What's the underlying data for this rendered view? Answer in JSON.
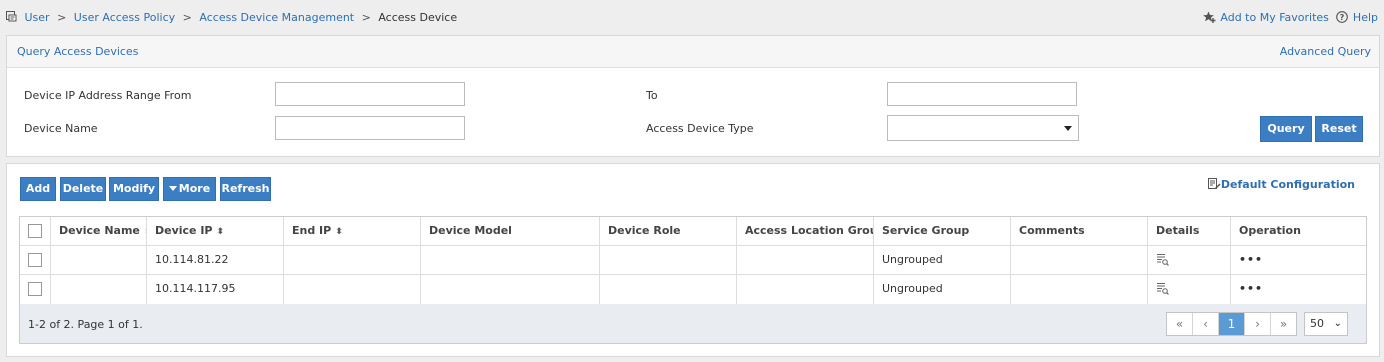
{
  "breadcrumb": {
    "items": [
      "User",
      "User Access Policy",
      "Access Device Management"
    ],
    "current": "Access Device",
    "separator": ">"
  },
  "top_links": {
    "favorites": "Add to My Favorites",
    "help": "Help"
  },
  "query": {
    "title": "Query Access Devices",
    "advanced": "Advanced Query",
    "ip_from_label": "Device IP Address Range From",
    "to_label": "To",
    "name_label": "Device Name",
    "type_label": "Access Device Type",
    "ip_from_value": "",
    "to_value": "",
    "name_value": "",
    "type_value": "",
    "query_button": "Query",
    "reset_button": "Reset"
  },
  "toolbar": {
    "add": "Add",
    "delete": "Delete",
    "modify": "Modify",
    "more": "More",
    "refresh": "Refresh",
    "default_config": "Default Configuration"
  },
  "table": {
    "columns": [
      "Device Name",
      "Device IP",
      "End IP",
      "Device Model",
      "Device Role",
      "Access Location Group",
      "Service Group",
      "Comments",
      "Details",
      "Operation"
    ],
    "rows": [
      {
        "device_name": "",
        "device_ip": "10.114.81.22",
        "end_ip": "",
        "device_model": "",
        "device_role": "",
        "location_group": "",
        "service_group": "Ungrouped",
        "comments": "",
        "operation": "•••"
      },
      {
        "device_name": "",
        "device_ip": "10.114.117.95",
        "end_ip": "",
        "device_model": "",
        "device_role": "",
        "location_group": "",
        "service_group": "Ungrouped",
        "comments": "",
        "operation": "•••"
      }
    ]
  },
  "pagination": {
    "info": "1-2 of 2. Page 1 of 1.",
    "first": "«",
    "prev": "‹",
    "current": "1",
    "next": "›",
    "last": "»",
    "page_size": "50"
  },
  "colors": {
    "accent": "#3c7ec4",
    "link": "#2f6fb0",
    "active_page": "#5b9bd5"
  }
}
